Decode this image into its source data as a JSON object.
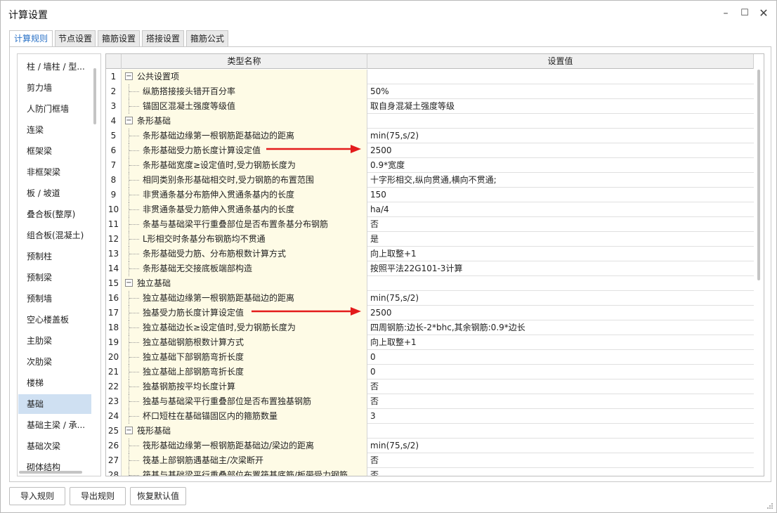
{
  "window": {
    "title": "计算设置"
  },
  "tabs": [
    {
      "label": "计算规则",
      "active": true
    },
    {
      "label": "节点设置"
    },
    {
      "label": "箍筋设置"
    },
    {
      "label": "搭接设置"
    },
    {
      "label": "箍筋公式"
    }
  ],
  "sidebar": {
    "items": [
      "柱 / 墙柱 / 型...",
      "剪力墙",
      "人防门框墙",
      "连梁",
      "框架梁",
      "非框架梁",
      "板 / 坡道",
      "叠合板(整厚)",
      "组合板(混凝土)",
      "预制柱",
      "预制梁",
      "预制墙",
      "空心楼盖板",
      "主肋梁",
      "次肋梁",
      "楼梯",
      "基础",
      "基础主梁 / 承...",
      "基础次梁",
      "砌体结构"
    ],
    "selected_index": 16
  },
  "grid": {
    "headers": {
      "name": "类型名称",
      "value": "设置值"
    },
    "rows": [
      {
        "num": "1",
        "group": true,
        "name": "公共设置项",
        "value": ""
      },
      {
        "num": "2",
        "name": "纵筋搭接接头错开百分率",
        "value": "50%"
      },
      {
        "num": "3",
        "name": "锚固区混凝土强度等级值",
        "value": "取自身混凝土强度等级"
      },
      {
        "num": "4",
        "group": true,
        "name": "条形基础",
        "value": ""
      },
      {
        "num": "5",
        "name": "条形基础边缘第一根钢筋距基础边的距离",
        "value": "min(75,s/2)"
      },
      {
        "num": "6",
        "name": "条形基础受力筋长度计算设定值",
        "value": "2500"
      },
      {
        "num": "7",
        "name": "条形基础宽度≥设定值时,受力钢筋长度为",
        "value": "0.9*宽度"
      },
      {
        "num": "8",
        "name": "相同类别条形基础相交时,受力钢筋的布置范围",
        "value": "十字形相交,纵向贯通,横向不贯通;"
      },
      {
        "num": "9",
        "name": "非贯通条基分布筋伸入贯通条基内的长度",
        "value": "150"
      },
      {
        "num": "10",
        "name": "非贯通条基受力筋伸入贯通条基内的长度",
        "value": "ha/4"
      },
      {
        "num": "11",
        "name": "条基与基础梁平行重叠部位是否布置条基分布钢筋",
        "value": "否"
      },
      {
        "num": "12",
        "name": "L形相交时条基分布钢筋均不贯通",
        "value": "是"
      },
      {
        "num": "13",
        "name": "条形基础受力筋、分布筋根数计算方式",
        "value": "向上取整+1"
      },
      {
        "num": "14",
        "name": "条形基础无交接底板端部构造",
        "value": "按照平法22G101-3计算"
      },
      {
        "num": "15",
        "group": true,
        "name": "独立基础",
        "value": ""
      },
      {
        "num": "16",
        "name": "独立基础边缘第一根钢筋距基础边的距离",
        "value": "min(75,s/2)"
      },
      {
        "num": "17",
        "name": "独基受力筋长度计算设定值",
        "value": "2500"
      },
      {
        "num": "18",
        "name": "独立基础边长≥设定值时,受力钢筋长度为",
        "value": "四周钢筋:边长-2*bhc,其余钢筋:0.9*边长"
      },
      {
        "num": "19",
        "name": "独立基础钢筋根数计算方式",
        "value": "向上取整+1"
      },
      {
        "num": "20",
        "name": "独立基础下部钢筋弯折长度",
        "value": "0"
      },
      {
        "num": "21",
        "name": "独立基础上部钢筋弯折长度",
        "value": "0"
      },
      {
        "num": "22",
        "name": "独基钢筋按平均长度计算",
        "value": "否"
      },
      {
        "num": "23",
        "name": "独基与基础梁平行重叠部位是否布置独基钢筋",
        "value": "否"
      },
      {
        "num": "24",
        "name": "杯口短柱在基础锚固区内的箍筋数量",
        "value": "3"
      },
      {
        "num": "25",
        "group": true,
        "name": "筏形基础",
        "value": ""
      },
      {
        "num": "26",
        "name": "筏形基础边缘第一根钢筋距基础边/梁边的距离",
        "value": "min(75,s/2)"
      },
      {
        "num": "27",
        "name": "筏基上部钢筋遇基础主/次梁断开",
        "value": "否"
      },
      {
        "num": "28",
        "name": "筏基与基础梁平行重叠部位布置筏基底筋/板带受力钢筋",
        "value": "否"
      }
    ]
  },
  "buttons": {
    "import": "导入规则",
    "export": "导出规则",
    "restore": "恢复默认值"
  },
  "colors": {
    "accent": "#2a72c7",
    "name_cell_bg": "#fefbe6",
    "selected_bg": "#cfe0f2",
    "annotation_arrow": "#e31b1b"
  }
}
